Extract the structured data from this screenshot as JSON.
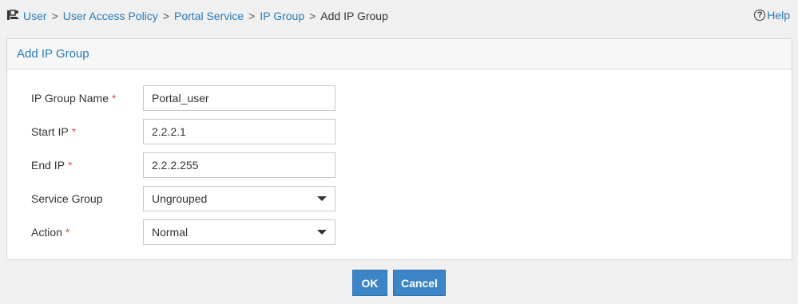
{
  "breadcrumb": {
    "icon": "user-access-icon",
    "items": [
      "User",
      "User Access Policy",
      "Portal Service",
      "IP Group"
    ],
    "separator": ">",
    "current": "Add IP Group"
  },
  "help": {
    "icon": "help-circle-icon",
    "label": "Help"
  },
  "panel": {
    "title": "Add IP Group"
  },
  "form": {
    "ip_group_name": {
      "label": "IP Group Name",
      "required_mark": "*",
      "value": "Portal_user"
    },
    "start_ip": {
      "label": "Start IP",
      "required_mark": "*",
      "value": "2.2.2.1"
    },
    "end_ip": {
      "label": "End IP",
      "required_mark": "*",
      "value": "2.2.2.255"
    },
    "service_group": {
      "label": "Service Group",
      "value": "Ungrouped"
    },
    "action": {
      "label": "Action",
      "required_mark": "*",
      "value": "Normal"
    }
  },
  "buttons": {
    "ok": "OK",
    "cancel": "Cancel"
  },
  "colors": {
    "link": "#2a7ab8",
    "button": "#3c85c6",
    "required": "#d9534f"
  }
}
